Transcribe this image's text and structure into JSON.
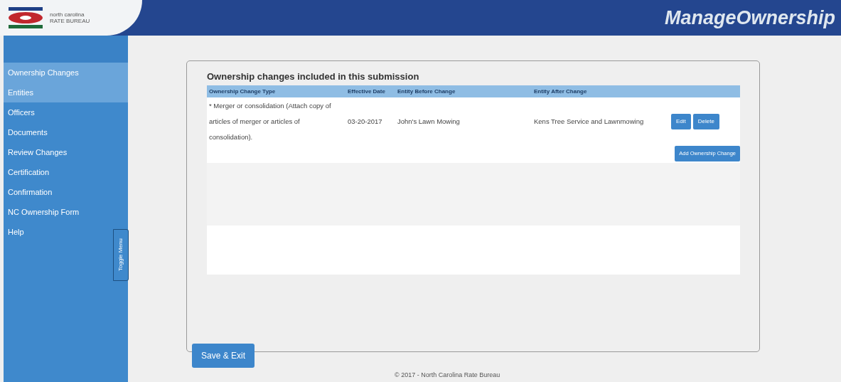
{
  "header": {
    "logo_text": [
      "north carolina",
      "RATE BUREAU"
    ],
    "title": "ManageOwnership"
  },
  "sidebar": {
    "items": [
      {
        "label": "Ownership Changes",
        "selected": true
      },
      {
        "label": "Entities",
        "selected": true
      },
      {
        "label": "Officers",
        "selected": false
      },
      {
        "label": "Documents",
        "selected": false
      },
      {
        "label": "Review Changes",
        "selected": false
      },
      {
        "label": "Certification",
        "selected": false
      },
      {
        "label": "Confirmation",
        "selected": false
      },
      {
        "label": "NC Ownership Form",
        "selected": false
      },
      {
        "label": "Help",
        "selected": false
      }
    ],
    "toggle": "Toggle Menu"
  },
  "panel": {
    "title": "Ownership changes included in this submission",
    "table": {
      "columns": [
        "Ownership Change Type",
        "Effective Date",
        "Entity Before Change",
        "Entity After Change"
      ],
      "rows": [
        {
          "cells": [
            "* Merger or consolidation (Attach copy of articles of merger or articles of consolidation).",
            "03-20-2017",
            "John's Lawn Mowing",
            "Kens Tree Service and Lawnmowing"
          ],
          "actions": [
            "Edit",
            "Delete"
          ]
        }
      ]
    },
    "add_button": "Add Ownership Change",
    "save_button": "Save & Exit"
  },
  "footer": "© 2017 - North Carolina Rate Bureau"
}
